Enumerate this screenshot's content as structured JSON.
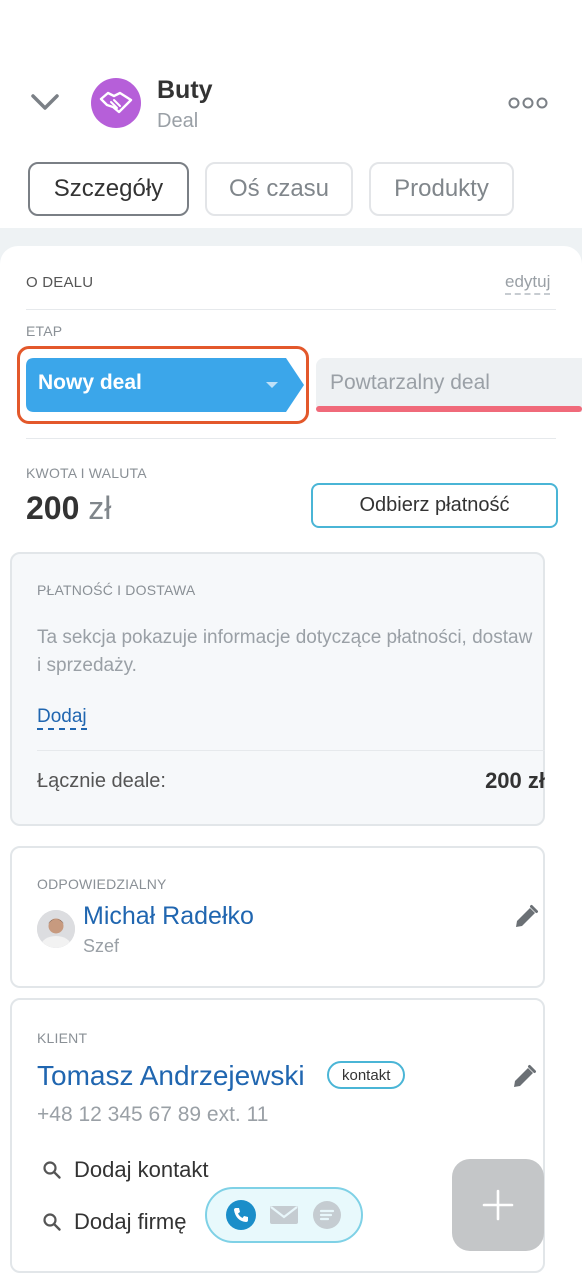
{
  "header": {
    "title": "Buty",
    "subtitle": "Deal",
    "back_icon": "chevron-down-icon",
    "avatar_icon": "handshake-icon",
    "menu_icon": "more-horizontal-icon"
  },
  "tabs": [
    {
      "label": "Szczegóły",
      "active": true
    },
    {
      "label": "Oś czasu",
      "active": false
    },
    {
      "label": "Produkty",
      "active": false
    }
  ],
  "about": {
    "section_title": "O DEALU",
    "edit_label": "edytuj",
    "stage_label": "ETAP",
    "stage_current": "Nowy deal",
    "stage_next": "Powtarzalny deal",
    "amount_label": "KWOTA I WALUTA",
    "amount_value": "200",
    "amount_currency": "zł",
    "payment_button": "Odbierz płatność"
  },
  "payment_delivery": {
    "label": "PŁATNOŚĆ I DOSTAWA",
    "description": "Ta sekcja pokazuje informacje dotyczące płatności, dostaw i sprzedaży.",
    "add_label": "Dodaj",
    "total_label": "Łącznie deale:",
    "total_value": "200 zł"
  },
  "responsible": {
    "label": "ODPOWIEDZIALNY",
    "name": "Michał Radełko",
    "role": "Szef"
  },
  "client": {
    "label": "KLIENT",
    "name": "Tomasz Andrzejewski",
    "badge": "kontakt",
    "phone": "+48 12 345 67 89 ext. 11",
    "add_contact": "Dodaj kontakt",
    "add_company": "Dodaj firmę"
  },
  "colors": {
    "stage_active": "#3ba6ea",
    "stage_next_bar": "#f06a7a",
    "highlight": "#e3582b",
    "link": "#2066b0",
    "accent_border": "#4ab5d6"
  }
}
